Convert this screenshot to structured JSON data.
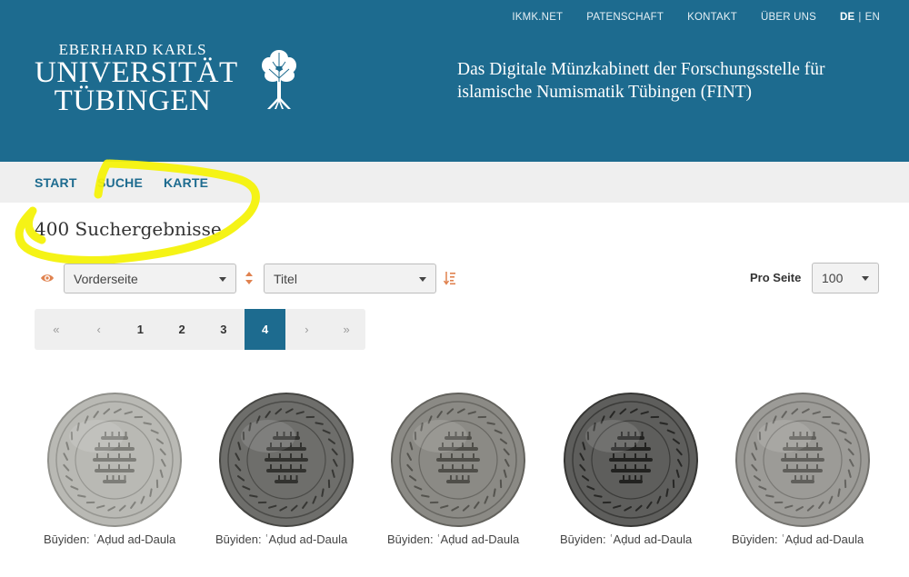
{
  "topnav": {
    "items": [
      "IKMK.NET",
      "PATENSCHAFT",
      "KONTAKT",
      "ÜBER UNS"
    ],
    "lang_de": "DE",
    "lang_sep": "|",
    "lang_en": "EN"
  },
  "logo": {
    "line1": "EBERHARD KARLS",
    "line2": "UNIVERSITÄT",
    "line3": "TÜBINGEN"
  },
  "site_title": {
    "line1": "Das Digitale Münzkabinett der Forschungsstelle für",
    "line2": "islamische Numismatik Tübingen (FINT)"
  },
  "mainnav": {
    "items": [
      "START",
      "SUCHE",
      "KARTE"
    ]
  },
  "results": {
    "heading": "400 Suchergebnisse"
  },
  "controls": {
    "view_select": "Vorderseite",
    "sort_select": "Titel",
    "per_page_label": "Pro Seite",
    "per_page_value": "100"
  },
  "pagination": {
    "first": "«",
    "prev": "‹",
    "pages": [
      "1",
      "2",
      "3",
      "4"
    ],
    "active_page": "4",
    "next": "›",
    "last": "»"
  },
  "coins": [
    {
      "label": "Būyiden: ʿAḍud ad-Daula",
      "tone": "#b9b9b4"
    },
    {
      "label": "Būyiden: ʿAḍud ad-Daula",
      "tone": "#6e6e6b"
    },
    {
      "label": "Būyiden: ʿAḍud ad-Daula",
      "tone": "#8b8a85"
    },
    {
      "label": "Būyiden: ʿAḍud ad-Daula",
      "tone": "#5e5e5c"
    },
    {
      "label": "Būyiden: ʿAḍud ad-Daula",
      "tone": "#9c9b97"
    }
  ],
  "colors": {
    "brand": "#1d6b8f",
    "highlight": "#f4f20a",
    "accent_icon": "#e0824f"
  }
}
